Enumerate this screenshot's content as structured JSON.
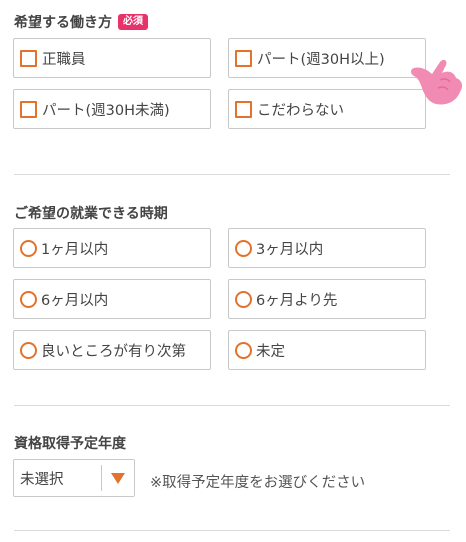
{
  "section1": {
    "title": "希望する働き方",
    "badge": "必須",
    "options": [
      "正職員",
      "パート(週30H以上)",
      "パート(週30H未満)",
      "こだわらない"
    ]
  },
  "section2": {
    "title": "ご希望の就業できる時期",
    "options": [
      "1ヶ月以内",
      "3ヶ月以内",
      "6ヶ月以内",
      "6ヶ月より先",
      "良いところが有り次第",
      "未定"
    ]
  },
  "section3": {
    "title": "資格取得予定年度",
    "select_value": "未選択",
    "note": "※取得予定年度をお選びください"
  },
  "colors": {
    "accent": "#e2722c",
    "badge": "#e8336a",
    "hand": "#f28bb4"
  },
  "icons": {
    "pointer": "pointing-hand-icon",
    "dropdown": "triangle-down-icon"
  }
}
